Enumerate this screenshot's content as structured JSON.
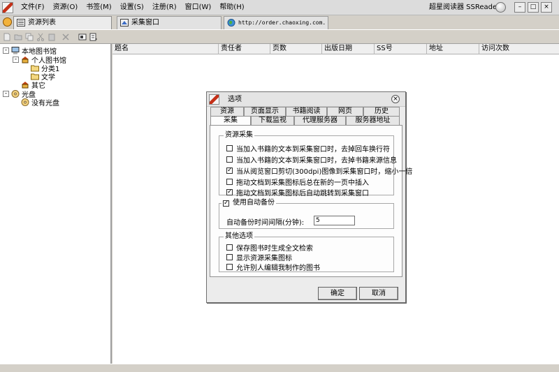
{
  "menu": {
    "items": [
      {
        "label": "文件(F)"
      },
      {
        "label": "资源(O)"
      },
      {
        "label": "书签(M)"
      },
      {
        "label": "设置(S)"
      },
      {
        "label": "注册(R)"
      },
      {
        "label": "窗口(W)"
      },
      {
        "label": "帮助(H)"
      }
    ],
    "app_title": "超星阅读器 SSReader"
  },
  "window_controls": {
    "minimize": "–",
    "restore": "□",
    "close": "×"
  },
  "tabs": [
    {
      "label": "资源列表",
      "icon": "list-icon"
    },
    {
      "label": "采集窗口",
      "icon": "collect-icon"
    },
    {
      "label": "http://order.chaoxing.com.",
      "icon": "globe-icon"
    }
  ],
  "tree": {
    "collapse_sign": "-",
    "nodes": [
      {
        "label": "本地图书馆",
        "icon": "computer-icon"
      },
      {
        "label": "个人图书馆",
        "icon": "library-icon"
      },
      {
        "label": "分类1",
        "icon": "folder-icon"
      },
      {
        "label": "文学",
        "icon": "folder-icon"
      },
      {
        "label": "其它",
        "icon": "library-icon"
      },
      {
        "label": "光盘",
        "icon": "cd-icon"
      },
      {
        "label": "没有光盘",
        "icon": "cd-icon"
      }
    ]
  },
  "list": {
    "columns": [
      "题名",
      "责任者",
      "页数",
      "出版日期",
      "SS号",
      "地址",
      "访问次数"
    ]
  },
  "dialog": {
    "title": "选项",
    "close_glyph": "×",
    "tabs_row1": [
      "资源",
      "页面显示",
      "书籍阅读",
      "网页",
      "历史"
    ],
    "tabs_row2": [
      "采集",
      "下载监视",
      "代理服务器",
      "服务器地址"
    ],
    "collect_group": {
      "label": "资源采集",
      "options": [
        {
          "label": "当加入书籍的文本到采集窗口时，去掉回车换行符",
          "checked": false
        },
        {
          "label": "当加入书籍的文本到采集窗口时，去掉书籍来源信息",
          "checked": false
        },
        {
          "label": "当从阅览窗口剪切(300dpi)图像到采集窗口时，缩小一倍",
          "checked": true
        },
        {
          "label": "拖动文档到采集图标后总在新的一页中插入",
          "checked": false
        },
        {
          "label": "拖动文档到采集图标后自动跳转到采集窗口",
          "checked": true
        }
      ]
    },
    "backup_group": {
      "label": "使用自动备份",
      "checked": true,
      "interval_label": "自动备份时间间隔(分钟):",
      "interval_value": "5"
    },
    "other_group": {
      "label": "其他选项",
      "options": [
        {
          "label": "保存图书时生成全文检索",
          "checked": false
        },
        {
          "label": "显示资源采集图标",
          "checked": false
        },
        {
          "label": "允许别人编辑我制作的图书",
          "checked": false
        }
      ]
    },
    "ok_label": "确定",
    "cancel_label": "取消"
  },
  "colors": {
    "accent_red": "#c43018",
    "face": "#d4d0c8"
  },
  "check_glyph": "✓"
}
